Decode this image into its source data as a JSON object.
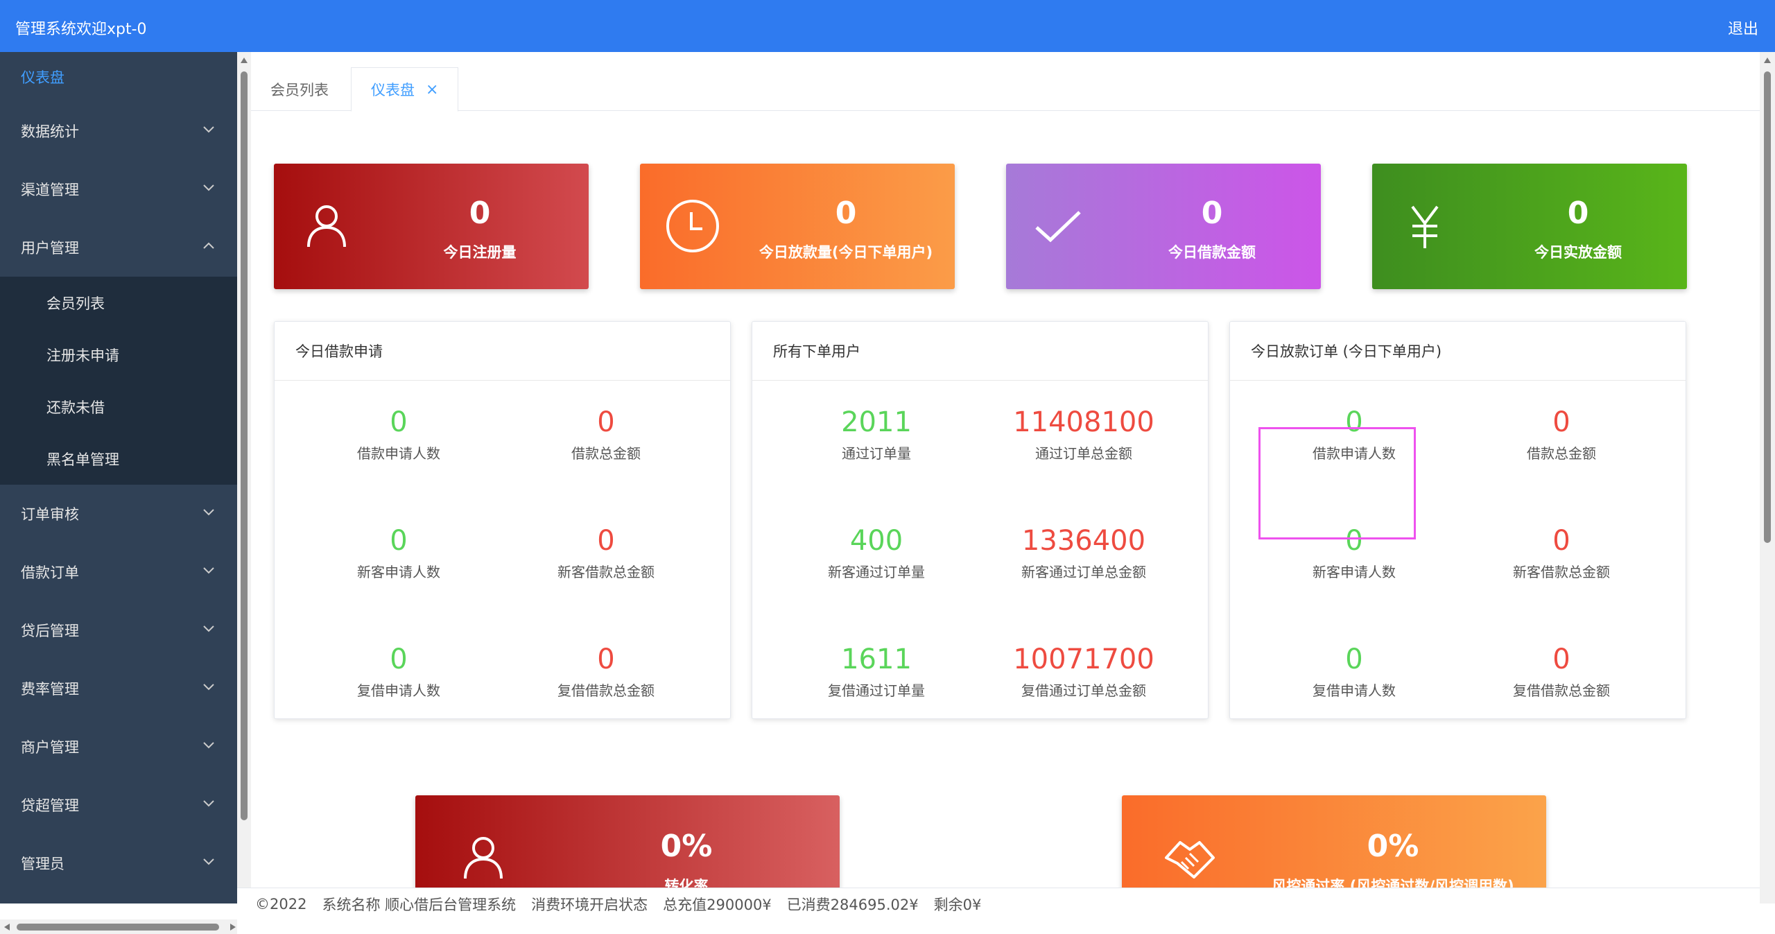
{
  "header": {
    "title": "管理系统欢迎xpt-0",
    "logout": "退出"
  },
  "sidebar": {
    "dashboard": "仪表盘",
    "items": [
      {
        "label": "数据统计"
      },
      {
        "label": "渠道管理"
      },
      {
        "label": "用户管理",
        "expanded": true,
        "children": [
          "会员列表",
          "注册未申请",
          "还款未借",
          "黑名单管理"
        ]
      },
      {
        "label": "订单审核"
      },
      {
        "label": "借款订单"
      },
      {
        "label": "贷后管理"
      },
      {
        "label": "费率管理"
      },
      {
        "label": "商户管理"
      },
      {
        "label": "贷超管理"
      },
      {
        "label": "管理员"
      }
    ]
  },
  "tabs": [
    {
      "label": "会员列表"
    },
    {
      "label": "仪表盘",
      "active": true
    }
  ],
  "stats": [
    {
      "value": "0",
      "label": "今日注册量",
      "icon": "user-icon"
    },
    {
      "value": "0",
      "label": "今日放款量(今日下单用户)",
      "icon": "clock-icon"
    },
    {
      "value": "0",
      "label": "今日借款金额",
      "icon": "check-icon"
    },
    {
      "value": "0",
      "label": "今日实放金额",
      "icon": "yen-icon"
    }
  ],
  "panels": [
    {
      "title": "今日借款申请",
      "cells": [
        {
          "value": "0",
          "caption": "借款申请人数"
        },
        {
          "value": "0",
          "caption": "借款总金额"
        },
        {
          "value": "0",
          "caption": "新客申请人数"
        },
        {
          "value": "0",
          "caption": "新客借款总金额"
        },
        {
          "value": "0",
          "caption": "复借申请人数"
        },
        {
          "value": "0",
          "caption": "复借借款总金额"
        }
      ]
    },
    {
      "title": "所有下单用户",
      "cells": [
        {
          "value": "2011",
          "caption": "通过订单量"
        },
        {
          "value": "11408100",
          "caption": "通过订单总金额"
        },
        {
          "value": "400",
          "caption": "新客通过订单量"
        },
        {
          "value": "1336400",
          "caption": "新客通过订单总金额"
        },
        {
          "value": "1611",
          "caption": "复借通过订单量"
        },
        {
          "value": "10071700",
          "caption": "复借通过订单总金额"
        }
      ]
    },
    {
      "title": "今日放款订单 (今日下单用户)",
      "cells": [
        {
          "value": "0",
          "caption": "借款申请人数"
        },
        {
          "value": "0",
          "caption": "借款总金额"
        },
        {
          "value": "0",
          "caption": "新客申请人数"
        },
        {
          "value": "0",
          "caption": "新客借款总金额"
        },
        {
          "value": "0",
          "caption": "复借申请人数"
        },
        {
          "value": "0",
          "caption": "复借借款总金额"
        }
      ]
    }
  ],
  "big_stats": [
    {
      "value": "0%",
      "label": "转化率",
      "icon": "user-icon"
    },
    {
      "value": "0%",
      "label": "风控通过率 (风控通过数/风控调用数)",
      "icon": "handshake-icon"
    }
  ],
  "footer": {
    "copyright": "©2022",
    "system_name": "系统名称 顺心借后台管理系统",
    "env": "消费环境开启状态",
    "recharge": "总充值290000¥",
    "consumed": "已消费284695.02¥",
    "remaining": "剩余0¥"
  },
  "colors": {
    "header": "#2f7bf0",
    "sidebar": "#304156",
    "submenu": "#1f2d3d",
    "active": "#409eff",
    "green": "#5ad55a",
    "red": "#ee4b40",
    "highlight": "#ee52ee"
  }
}
